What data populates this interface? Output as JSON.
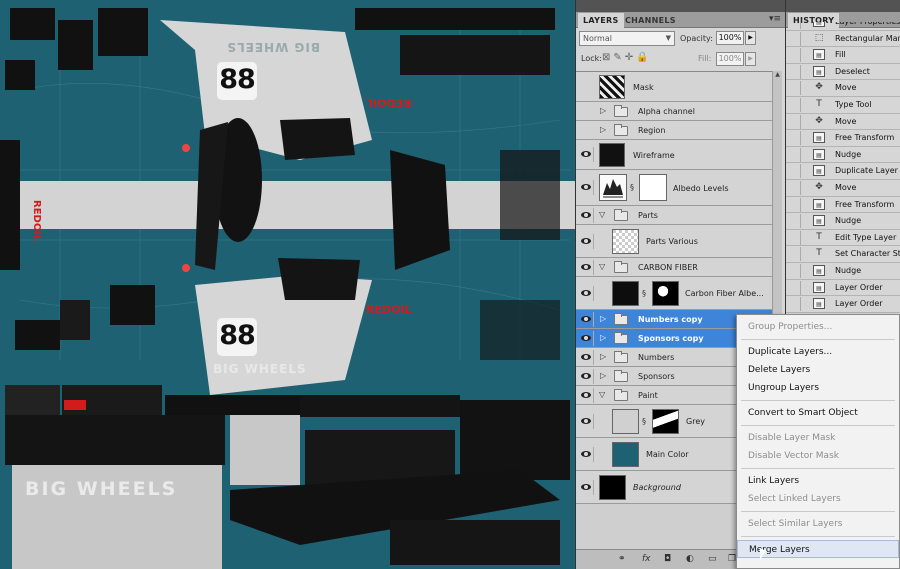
{
  "canvas": {
    "number_top": "88",
    "number_bottom": "88",
    "big_wheels_top": "BIG WHEELS",
    "big_wheels_mid": "BIG WHEELS",
    "big_wheels_bottom": "BIG WHEELS",
    "redoil_top": "REDOIL",
    "redoil_side": "REDOIL",
    "redoil_bottom": "REDOIL",
    "colors": {
      "paint": "#1e6173",
      "stripe": "#d6d6d6",
      "parts": "#101010",
      "decal": "#d21c1c"
    }
  },
  "layers_panel": {
    "tabs": [
      "LAYERS",
      "CHANNELS"
    ],
    "menu_icon": "panel-menu-icon",
    "blend_mode": "Normal",
    "opacity_label": "Opacity:",
    "opacity_value": "100%",
    "lock_label": "Lock:",
    "fill_label": "Fill:",
    "fill_value": "100%",
    "layers": [
      {
        "name": "Mask",
        "kind": "layer"
      },
      {
        "name": "Alpha channel",
        "kind": "group"
      },
      {
        "name": "Region",
        "kind": "group"
      },
      {
        "name": "Wireframe",
        "kind": "layer"
      },
      {
        "name": "Albedo Levels",
        "kind": "adjustment"
      },
      {
        "name": "Parts",
        "kind": "group"
      },
      {
        "name": "Parts Various",
        "kind": "layer"
      },
      {
        "name": "CARBON FIBER",
        "kind": "group"
      },
      {
        "name": "Carbon Fiber Albe...",
        "kind": "layer"
      },
      {
        "name": "Numbers copy",
        "kind": "group",
        "selected": true
      },
      {
        "name": "Sponsors copy",
        "kind": "group",
        "selected": true
      },
      {
        "name": "Numbers",
        "kind": "group"
      },
      {
        "name": "Sponsors",
        "kind": "group"
      },
      {
        "name": "Paint",
        "kind": "group"
      },
      {
        "name": "Grey",
        "kind": "layer"
      },
      {
        "name": "Main Color",
        "kind": "adjustment"
      },
      {
        "name": "Background",
        "kind": "background"
      }
    ],
    "bottom_icons": [
      "link-icon",
      "fx-icon",
      "mask-icon",
      "adjustment-icon",
      "folder-icon",
      "new-layer-icon",
      "trash-icon"
    ],
    "bottom_fx": "fx"
  },
  "history_panel": {
    "title": "HISTORY",
    "items": [
      {
        "name": "Layer Properties",
        "icon": "layer-icon"
      },
      {
        "name": "Rectangular Marquee",
        "icon": "marquee-icon"
      },
      {
        "name": "Fill",
        "icon": "layer-icon"
      },
      {
        "name": "Deselect",
        "icon": "layer-icon"
      },
      {
        "name": "Move",
        "icon": "move-icon"
      },
      {
        "name": "Type Tool",
        "icon": "type-icon"
      },
      {
        "name": "Move",
        "icon": "move-icon"
      },
      {
        "name": "Free Transform",
        "icon": "layer-icon"
      },
      {
        "name": "Nudge",
        "icon": "layer-icon"
      },
      {
        "name": "Duplicate Layer",
        "icon": "layer-icon"
      },
      {
        "name": "Move",
        "icon": "move-icon"
      },
      {
        "name": "Free Transform",
        "icon": "layer-icon"
      },
      {
        "name": "Nudge",
        "icon": "layer-icon"
      },
      {
        "name": "Edit Type Layer",
        "icon": "type-icon"
      },
      {
        "name": "Set Character Style",
        "icon": "type-icon"
      },
      {
        "name": "Nudge",
        "icon": "layer-icon"
      },
      {
        "name": "Layer Order",
        "icon": "layer-icon"
      },
      {
        "name": "Layer Order",
        "icon": "layer-icon"
      }
    ]
  },
  "context_menu": {
    "items": [
      {
        "label": "Group Properties...",
        "disabled": true
      },
      {
        "sep": true
      },
      {
        "label": "Duplicate Layers...",
        "disabled": false
      },
      {
        "label": "Delete Layers",
        "disabled": false
      },
      {
        "label": "Ungroup Layers",
        "disabled": false
      },
      {
        "sep": true
      },
      {
        "label": "Convert to Smart Object",
        "disabled": false
      },
      {
        "sep": true
      },
      {
        "label": "Disable Layer Mask",
        "disabled": true
      },
      {
        "label": "Disable Vector Mask",
        "disabled": true
      },
      {
        "sep": true
      },
      {
        "label": "Link Layers",
        "disabled": false
      },
      {
        "label": "Select Linked Layers",
        "disabled": true
      },
      {
        "sep": true
      },
      {
        "label": "Select Similar Layers",
        "disabled": true
      },
      {
        "sep": true
      },
      {
        "label": "Merge Layers",
        "disabled": false,
        "hover": true
      }
    ]
  }
}
